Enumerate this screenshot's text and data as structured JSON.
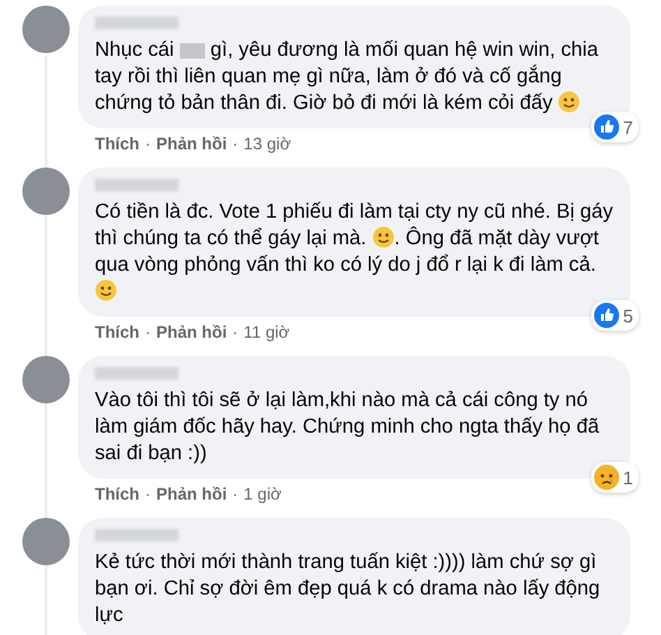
{
  "comments": [
    {
      "body": [
        {
          "kind": "text",
          "text": "Nhục cái "
        },
        {
          "kind": "redacted"
        },
        {
          "kind": "text",
          "text": " gì, yêu đương là mối quan hệ win win, chia tay rồi thì liên quan mẹ gì nữa, làm ở đó và cố gắng chứng tỏ bản thân đi. Giờ bỏ đi mới là kém cỏi đấy "
        },
        {
          "kind": "emoji"
        }
      ],
      "reaction": {
        "kind": "like",
        "count": "7"
      },
      "footer": {
        "like": "Thích",
        "separator": "·",
        "reply": "Phản hồi",
        "time": "13 giờ"
      }
    },
    {
      "body": [
        {
          "kind": "text",
          "text": "Có tiền là đc. Vote 1 phiếu đi làm tại cty ny cũ nhé. Bị gáy thì chúng ta có thể gáy lại mà. "
        },
        {
          "kind": "emoji"
        },
        {
          "kind": "text",
          "text": ". Ông đã mặt dày vượt qua vòng phỏng vấn thì ko có lý do j đổ r lại k đi làm cả. "
        },
        {
          "kind": "emoji"
        }
      ],
      "reaction": {
        "kind": "like",
        "count": "5"
      },
      "footer": {
        "like": "Thích",
        "separator": "·",
        "reply": "Phản hồi",
        "time": "11 giờ"
      }
    },
    {
      "body": [
        {
          "kind": "text",
          "text": "Vào tôi thì tôi sẽ ở lại làm,khi nào mà cả cái công ty nó làm giám đốc hãy hay. Chứng minh cho ngta thấy họ đã sai đi bạn :))"
        }
      ],
      "reaction": {
        "kind": "sad",
        "count": "1"
      },
      "footer": {
        "like": "Thích",
        "separator": "·",
        "reply": "Phản hồi",
        "time": "1 giờ"
      }
    },
    {
      "body": [
        {
          "kind": "text",
          "text": "Kẻ tức thời mới thành trang tuấn kiệt :)))) làm chứ sợ gì bạn ơi. Chỉ sợ đời êm đẹp quá k có drama nào lấy động lực"
        }
      ]
    }
  ]
}
